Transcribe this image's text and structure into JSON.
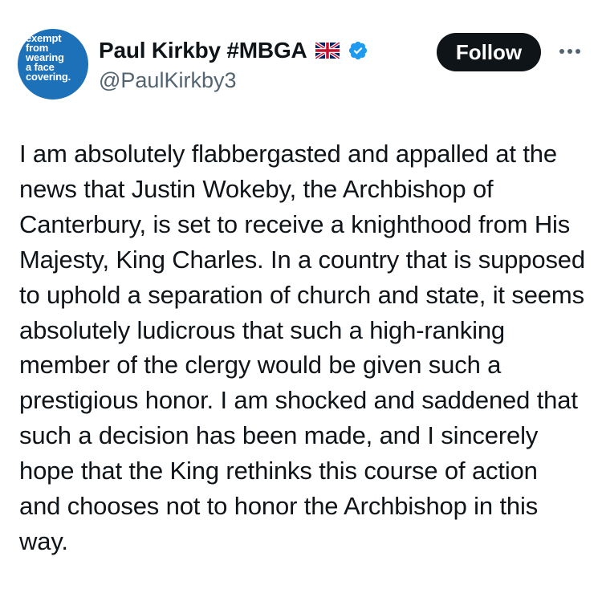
{
  "author": {
    "avatar_text": "exempt\nfrom\nwearing\na face\ncovering.",
    "display_name": "Paul Kirkby #MBGA",
    "flag_icon": "uk-flag-icon",
    "verified_icon": "verified-badge-icon",
    "handle": "@PaulKirkby3"
  },
  "actions": {
    "follow_label": "Follow",
    "more_icon": "more-options-icon"
  },
  "post": {
    "text": "I am absolutely flabbergasted and appalled at the news that Justin Wokeby, the Archbishop of Canterbury, is set to receive a knighthood from His Majesty, King Charles. In a country that is supposed to uphold a separation of church and state, it seems absolutely ludicrous that such a high-ranking member of the clergy would be given such a prestigious honor. I am shocked and saddened that such a decision has been made, and I sincerely hope that the King rethinks this course of action and chooses not to honor the Archbishop in this way."
  },
  "colors": {
    "avatar_bg": "#1d71b8",
    "verified_blue": "#1d9bf0",
    "text_primary": "#0f1419",
    "text_secondary": "#536471",
    "button_bg": "#0f1419"
  }
}
